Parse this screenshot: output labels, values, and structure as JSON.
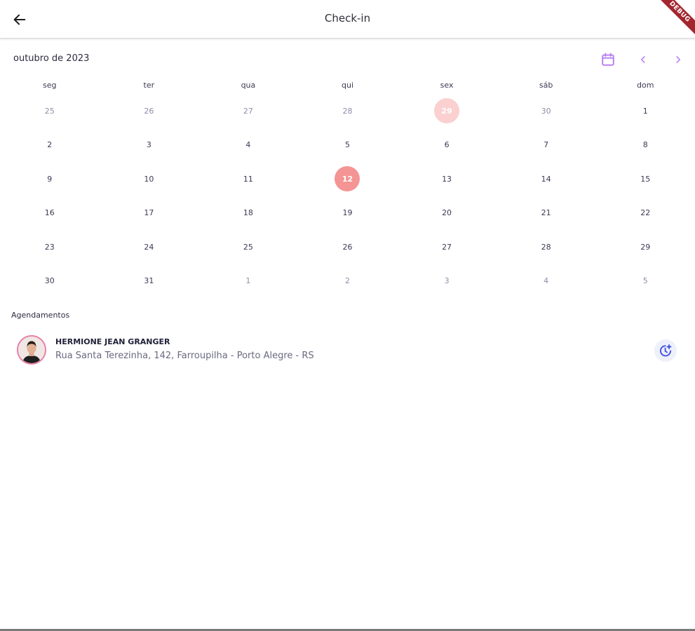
{
  "appbar": {
    "title": "Check-in",
    "back_icon": "arrow-left-icon",
    "debug_label": "DEBUG"
  },
  "calendar": {
    "month_label": "outubro de 2023",
    "calendar_icon": "calendar-icon",
    "prev_icon": "chevron-left-icon",
    "next_icon": "chevron-right-icon",
    "accent_color": "#b57bf2",
    "weekdays": [
      "seg",
      "ter",
      "qua",
      "qui",
      "sex",
      "sáb",
      "dom"
    ],
    "weeks": [
      [
        {
          "label": "25",
          "muted": true
        },
        {
          "label": "26",
          "muted": true
        },
        {
          "label": "27",
          "muted": true
        },
        {
          "label": "28",
          "muted": true
        },
        {
          "label": "29",
          "muted": false,
          "state": "today"
        },
        {
          "label": "30",
          "muted": true
        },
        {
          "label": "1"
        }
      ],
      [
        {
          "label": "2"
        },
        {
          "label": "3"
        },
        {
          "label": "4"
        },
        {
          "label": "5"
        },
        {
          "label": "6"
        },
        {
          "label": "7"
        },
        {
          "label": "8"
        }
      ],
      [
        {
          "label": "9"
        },
        {
          "label": "10"
        },
        {
          "label": "11"
        },
        {
          "label": "12",
          "state": "selected"
        },
        {
          "label": "13"
        },
        {
          "label": "14"
        },
        {
          "label": "15"
        }
      ],
      [
        {
          "label": "16"
        },
        {
          "label": "17"
        },
        {
          "label": "18"
        },
        {
          "label": "19"
        },
        {
          "label": "20"
        },
        {
          "label": "21"
        },
        {
          "label": "22"
        }
      ],
      [
        {
          "label": "23"
        },
        {
          "label": "24"
        },
        {
          "label": "25"
        },
        {
          "label": "26"
        },
        {
          "label": "27"
        },
        {
          "label": "28"
        },
        {
          "label": "29"
        }
      ],
      [
        {
          "label": "30"
        },
        {
          "label": "31"
        },
        {
          "label": "1",
          "muted": true
        },
        {
          "label": "2",
          "muted": true
        },
        {
          "label": "3",
          "muted": true
        },
        {
          "label": "4",
          "muted": true
        },
        {
          "label": "5",
          "muted": true
        }
      ]
    ],
    "today_color": "#fbd0d0",
    "selected_color": "#f59494"
  },
  "appointments": {
    "section_title": "Agendamentos",
    "items": [
      {
        "name": "HERMIONE JEAN GRANGER",
        "address": "Rua Santa Terezinha, 142, Farroupilha - Porto Alegre - RS",
        "avatar_icon": "avatar",
        "action_icon": "clock-plus-icon",
        "action_color": "#3b4fe0"
      }
    ]
  }
}
